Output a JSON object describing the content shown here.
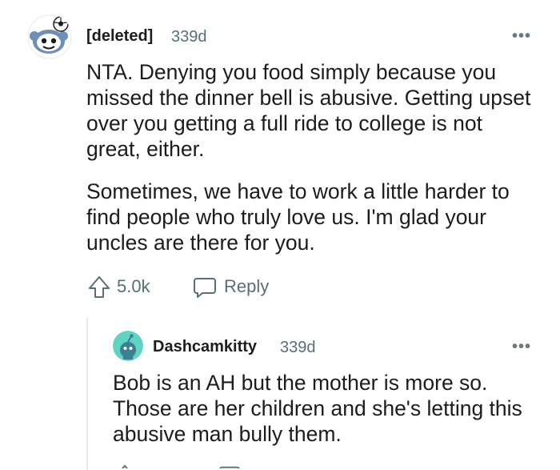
{
  "comment": {
    "author": "[deleted]",
    "age": "339d",
    "more_label": "•••",
    "paragraphs": [
      "NTA. Denying you food simply because you missed the dinner bell is abusive. Getting upset over you getting a full ride to college is not great, either.",
      "Sometimes, we have to work a little harder to find people who truly love us. I'm glad your uncles are there for you."
    ],
    "votes": "5.0k",
    "reply_label": "Reply",
    "avatar_icon": "snoo-avatar-icon"
  },
  "reply": {
    "author": "Dashcamkitty",
    "age": "339d",
    "more_label": "•••",
    "text": "Bob is an AH but the mother is more so. Those are her children and she's letting this abusive man bully them.",
    "avatar_icon": "snoo-avatar-icon",
    "avatar_color": "#5fd3c4"
  },
  "colors": {
    "text": "#1c1c1c",
    "meta": "#576f76",
    "thread_line": "#e4e8ea"
  }
}
